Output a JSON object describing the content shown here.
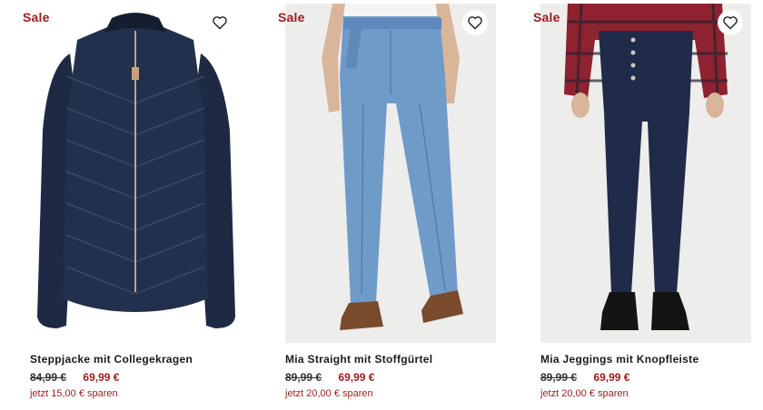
{
  "colors": {
    "sale": "#9b1b1f",
    "text": "#1a1a1a",
    "image_bg": "#ededeb"
  },
  "products": [
    {
      "badge": "Sale",
      "name": "Steppjacke mit Collegekragen",
      "old_price": "84,99 €",
      "new_price": "69,99 €",
      "savings": "jetzt 15,00 € sparen",
      "image": "navy quilted jacket"
    },
    {
      "badge": "Sale",
      "name": "Mia Straight mit Stoffgürtel",
      "old_price": "89,99 €",
      "new_price": "69,99 €",
      "savings": "jetzt 20,00 € sparen",
      "image": "light blue straight jeans with brown boots"
    },
    {
      "badge": "Sale",
      "name": "Mia Jeggings mit Knopfleiste",
      "old_price": "89,99 €",
      "new_price": "69,99 €",
      "savings": "jetzt 20,00 € sparen",
      "image": "dark blue jeggings with plaid shirt and black boots"
    }
  ],
  "icons": {
    "favorite": "heart-outline-icon"
  }
}
